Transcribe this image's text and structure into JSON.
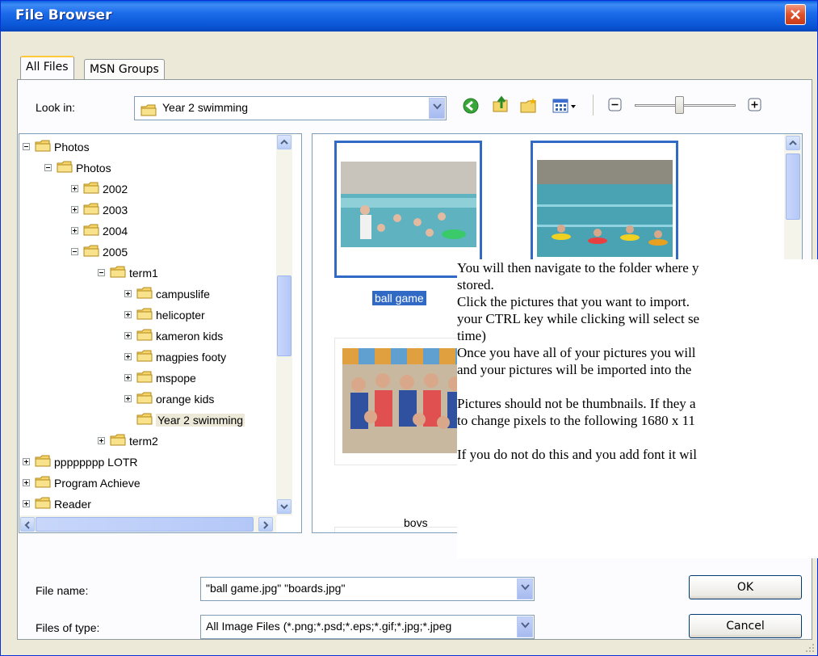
{
  "window": {
    "title": "File Browser"
  },
  "tabs": [
    {
      "label": "All Files"
    },
    {
      "label": "MSN Groups"
    }
  ],
  "look_in": {
    "label": "Look in:",
    "value": "Year 2 swimming"
  },
  "tree": {
    "items": [
      {
        "label": "Photos",
        "level": 0,
        "expander": "minus"
      },
      {
        "label": "Photos",
        "level": 1,
        "expander": "minus"
      },
      {
        "label": "2002",
        "level": 2,
        "expander": "plus"
      },
      {
        "label": "2003",
        "level": 2,
        "expander": "plus"
      },
      {
        "label": "2004",
        "level": 2,
        "expander": "plus"
      },
      {
        "label": "2005",
        "level": 2,
        "expander": "minus"
      },
      {
        "label": "term1",
        "level": 3,
        "expander": "minus"
      },
      {
        "label": "campuslife",
        "level": 4,
        "expander": "plus"
      },
      {
        "label": "helicopter",
        "level": 4,
        "expander": "plus"
      },
      {
        "label": "kameron kids",
        "level": 4,
        "expander": "plus"
      },
      {
        "label": "magpies footy",
        "level": 4,
        "expander": "plus"
      },
      {
        "label": "mspope",
        "level": 4,
        "expander": "plus"
      },
      {
        "label": "orange kids",
        "level": 4,
        "expander": "plus"
      },
      {
        "label": "Year 2 swimming",
        "level": 4,
        "expander": "none",
        "selected": true
      },
      {
        "label": "term2",
        "level": 3,
        "expander": "plus"
      },
      {
        "label": "pppppppp LOTR",
        "level": 0,
        "expander": "plus"
      },
      {
        "label": "Program Achieve",
        "level": 0,
        "expander": "plus"
      },
      {
        "label": "Reader",
        "level": 0,
        "expander": "plus"
      }
    ]
  },
  "thumbnails": [
    {
      "caption": "ball game",
      "selected": true
    },
    {
      "caption": "",
      "selected": true
    },
    {
      "caption": "boys",
      "selected": false
    }
  ],
  "overlay": {
    "lines": [
      "You will then navigate to the folder where y",
      "stored.",
      "Click the pictures that you want to import.",
      "your CTRL key while clicking will select se",
      "time)",
      "Once you have all of your pictures you will",
      "and your pictures will be imported into the",
      "",
      "Pictures should not be thumbnails.  If they a",
      "to change pixels to the following 1680 x 11",
      "",
      "If you do not do this and you add font it wil"
    ]
  },
  "file_name": {
    "label": "File name:",
    "value": "\"ball game.jpg\" \"boards.jpg\""
  },
  "file_type": {
    "label": "Files of type:",
    "value": "All Image Files (*.png;*.psd;*.eps;*.gif;*.jpg;*.jpeg"
  },
  "buttons": {
    "ok": "OK",
    "cancel": "Cancel"
  },
  "colors": {
    "title_bar": "#0a56d6",
    "selection": "#316ac5",
    "dialog_bg": "#ece9d8"
  },
  "icons": [
    "back-icon",
    "up-folder-icon",
    "new-folder-icon",
    "views-icon",
    "zoom-out-icon",
    "zoom-in-icon"
  ]
}
